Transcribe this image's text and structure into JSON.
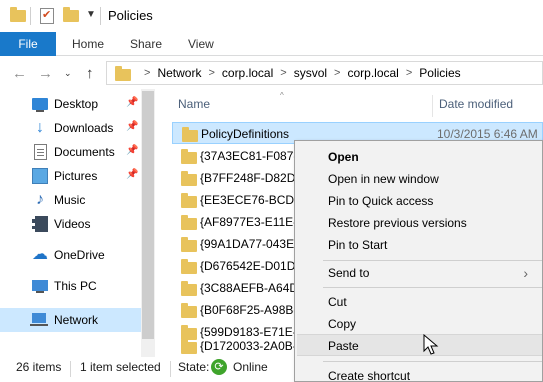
{
  "window": {
    "title": "Policies"
  },
  "ribbon": {
    "tabs": [
      "File",
      "Home",
      "Share",
      "View"
    ]
  },
  "address": {
    "crumbs": [
      "Network",
      "corp.local",
      "sysvol",
      "corp.local",
      "Policies"
    ],
    "separator": ">"
  },
  "nav": {
    "items": [
      {
        "label": "Desktop",
        "icon": "desktop-icon",
        "pinned": true
      },
      {
        "label": "Downloads",
        "icon": "downloads-icon",
        "pinned": true
      },
      {
        "label": "Documents",
        "icon": "documents-icon",
        "pinned": true
      },
      {
        "label": "Pictures",
        "icon": "pictures-icon",
        "pinned": true
      },
      {
        "label": "Music",
        "icon": "music-icon",
        "pinned": false
      },
      {
        "label": "Videos",
        "icon": "videos-icon",
        "pinned": false
      },
      {
        "label": "OneDrive",
        "icon": "onedrive-icon",
        "pinned": false
      },
      {
        "label": "This PC",
        "icon": "this-pc-icon",
        "pinned": false
      },
      {
        "label": "Network",
        "icon": "network-icon",
        "pinned": false,
        "selected": true
      }
    ]
  },
  "content": {
    "columns": {
      "name": "Name",
      "date": "Date modified"
    },
    "rows": [
      {
        "name": "PolicyDefinitions",
        "date": "10/3/2015 6:46 AM",
        "selected": true
      },
      {
        "name": "{37A3EC81-F087-4"
      },
      {
        "name": "{B7FF248F-D82D-4"
      },
      {
        "name": "{EE3ECE76-BCDA-"
      },
      {
        "name": "{AF8977E3-E11E-4"
      },
      {
        "name": "{99A1DA77-043E-"
      },
      {
        "name": "{D676542E-D01D-"
      },
      {
        "name": "{3C88AEFB-A64D-"
      },
      {
        "name": "{B0F68F25-A98B-4"
      },
      {
        "name": "{599D9183-E71E-4"
      },
      {
        "name": "{D1720033-2A0B-"
      }
    ]
  },
  "status": {
    "items": "26 items",
    "selected": "1 item selected",
    "state_label": "State:",
    "state_value": "Online"
  },
  "context_menu": {
    "items": [
      {
        "label": "Open",
        "bold": true
      },
      {
        "label": "Open in new window"
      },
      {
        "label": "Pin to Quick access"
      },
      {
        "label": "Restore previous versions"
      },
      {
        "label": "Pin to Start"
      },
      {
        "label": "Send to",
        "submenu": true
      },
      {
        "label": "Cut"
      },
      {
        "label": "Copy"
      },
      {
        "label": "Paste",
        "hover": true
      },
      {
        "label": "Create shortcut"
      }
    ]
  },
  "colors": {
    "accent": "#1979ca",
    "selection": "#cce8ff",
    "folder": "#e8c35c"
  }
}
